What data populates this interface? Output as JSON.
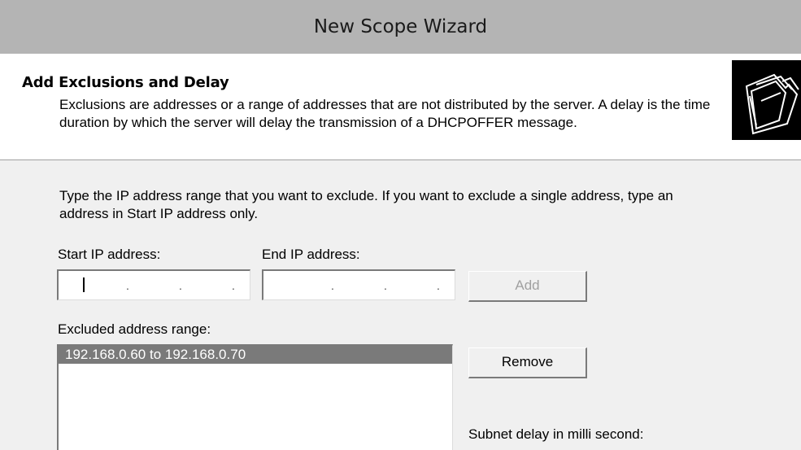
{
  "window": {
    "title": "New Scope Wizard"
  },
  "header": {
    "title": "Add Exclusions and Delay",
    "description": "Exclusions are addresses or a range of addresses that are not distributed by the server. A delay is the time duration by which the server will delay the transmission of a DHCPOFFER message.",
    "icon": "folders-icon"
  },
  "form": {
    "instructions": "Type the IP address range that you want to exclude. If you want to exclude a single address, type an address in Start IP address only.",
    "start_ip_label": "Start IP address:",
    "end_ip_label": "End IP address:",
    "start_ip_value": "",
    "end_ip_value": "",
    "add_button": "Add",
    "excluded_label": "Excluded address range:",
    "excluded_items": [
      "192.168.0.60 to 192.168.0.70"
    ],
    "remove_button": "Remove",
    "subnet_delay_label": "Subnet delay in milli second:"
  }
}
